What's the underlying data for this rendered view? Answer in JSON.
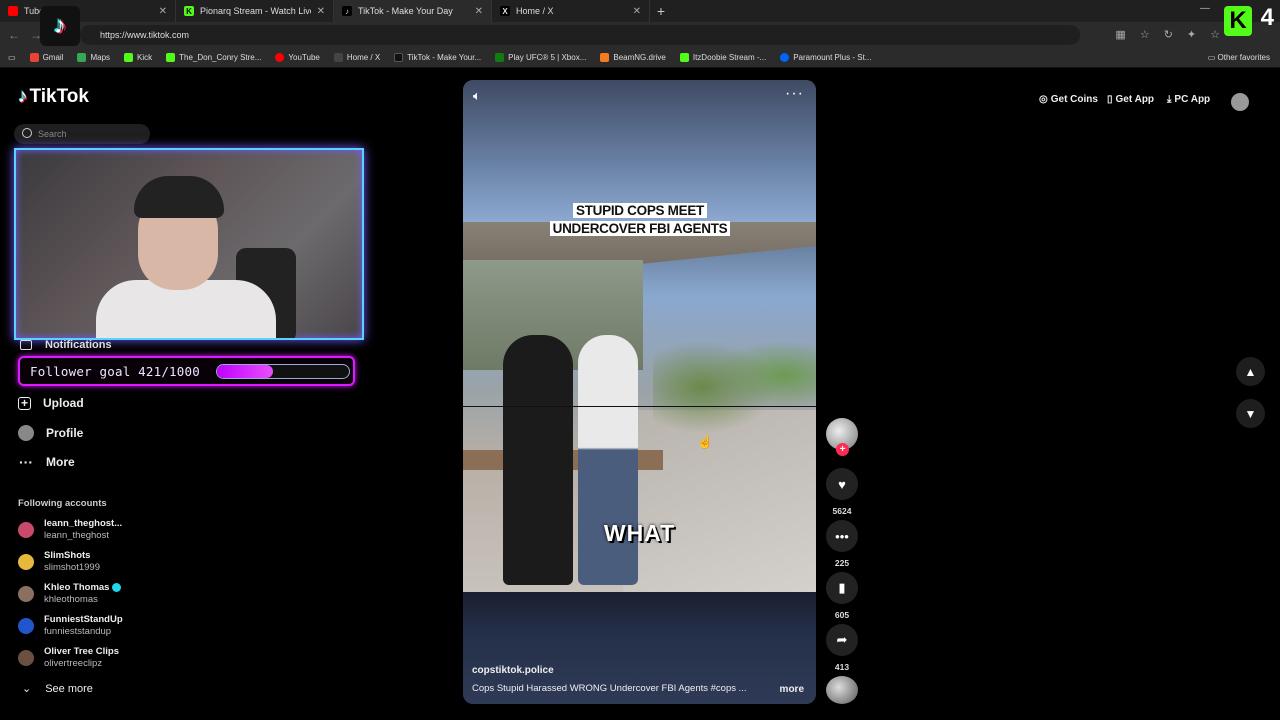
{
  "browser": {
    "tabs": [
      {
        "label": "Tube",
        "active": false
      },
      {
        "label": "Pionarq Stream - Watch Live",
        "active": false
      },
      {
        "label": "TikTok - Make Your Day",
        "active": true
      },
      {
        "label": "Home / X",
        "active": false
      }
    ],
    "url": "https://www.tiktok.com",
    "bookmarks": [
      "Gmail",
      "Maps",
      "Kick",
      "The_Don_Conry Stre...",
      "YouTube",
      "Home / X",
      "TikTok - Make Your...",
      "Play UFC® 5 | Xbox...",
      "BeamNG.drive",
      "ItzDoobie Stream -...",
      "Paramount Plus - St..."
    ],
    "other_favorites": "Other favorites"
  },
  "overlay": {
    "kick_number": "4",
    "follower_goal_text": "Follower goal 421/1000",
    "follower_goal_current": 421,
    "follower_goal_target": 1000
  },
  "tiktok": {
    "logo": "TikTok",
    "search_placeholder": "Search",
    "nav": {
      "notifications": "Notifications",
      "upload": "Upload",
      "profile": "Profile",
      "more": "More"
    },
    "following_title": "Following accounts",
    "accounts": [
      {
        "name": "leann_theghost...",
        "handle": "leann_theghost",
        "verified": false,
        "color": "#c94a6a"
      },
      {
        "name": "SlimShots",
        "handle": "slimshot1999",
        "verified": false,
        "color": "#e6b93c"
      },
      {
        "name": "Khleo Thomas",
        "handle": "khleothomas",
        "verified": true,
        "color": "#8a7060"
      },
      {
        "name": "FunniestStandUp",
        "handle": "funnieststandup",
        "verified": false,
        "color": "#2255cc"
      },
      {
        "name": "Oliver Tree Clips",
        "handle": "olivertreeclipz",
        "verified": false,
        "color": "#6a5040"
      }
    ],
    "see_more": "See more",
    "top_right": {
      "get_coins": "Get Coins",
      "get_app": "Get App",
      "pc_app": "PC App"
    },
    "video": {
      "title_line1": "STUPID COPS MEET",
      "title_line2": "UNDERCOVER FBI AGENTS",
      "caption_word": "WHAT",
      "author": "copstiktok.police",
      "description": "Cops Stupid Harassed WRONG Undercover FBI Agents #cops ...",
      "more_label": "more"
    },
    "actions": {
      "likes": "5624",
      "comments": "225",
      "saves": "605",
      "shares": "413"
    }
  }
}
